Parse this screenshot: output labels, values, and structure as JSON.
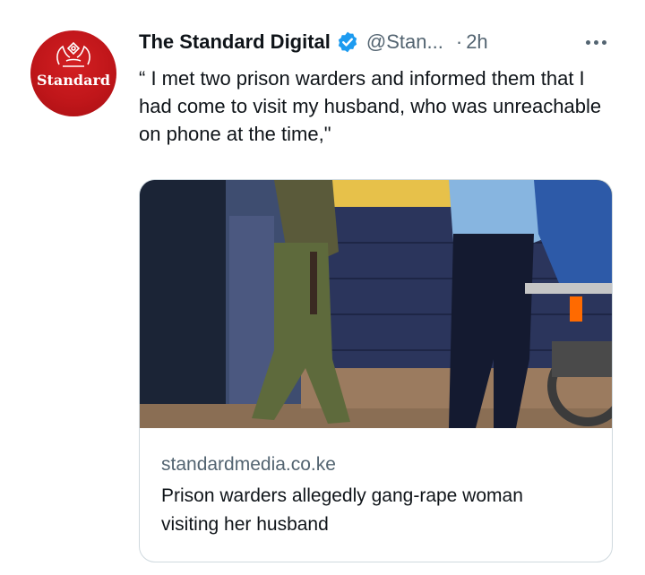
{
  "author": {
    "avatar_text": "Standard",
    "display_name": "The Standard Digital",
    "handle": "@Stan...",
    "separator": "·",
    "time": "2h"
  },
  "tweet": {
    "text": "“ I met two prison warders and informed them that I had come to visit my husband, who was unreachable on phone at the time,\""
  },
  "card": {
    "domain": "standardmedia.co.ke",
    "title": "Prison warders allegedly gang-rape woman visiting her husband"
  },
  "icons": {
    "verified": "verified-badge-icon",
    "more": "more-options-icon"
  },
  "colors": {
    "brand_red": "#c8161b",
    "verified_blue": "#1d9bf0",
    "secondary_text": "#536471",
    "primary_text": "#0f1419"
  }
}
